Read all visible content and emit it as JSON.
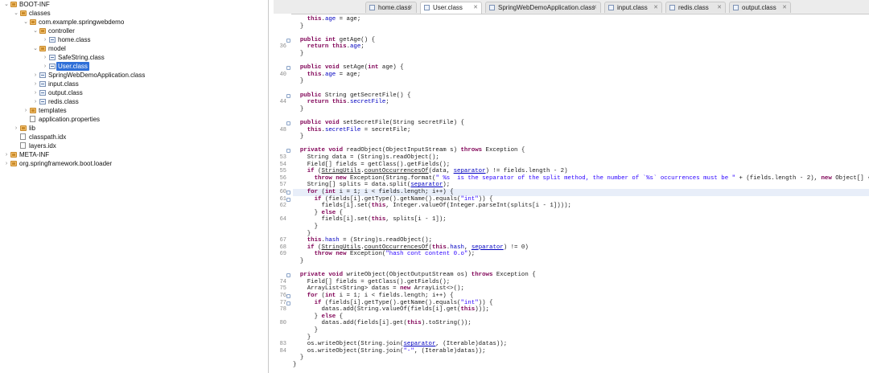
{
  "tree": {
    "items": [
      {
        "label": "BOOT-INF",
        "icon": "package-icon",
        "depth": 0,
        "arrow": "chevron-down"
      },
      {
        "label": "classes",
        "icon": "package-icon",
        "depth": 1,
        "arrow": "chevron-down"
      },
      {
        "label": "com.example.springwebdemo",
        "icon": "package-icon",
        "depth": 2,
        "arrow": "chevron-down"
      },
      {
        "label": "controller",
        "icon": "package-icon",
        "depth": 3,
        "arrow": "chevron-down"
      },
      {
        "label": "home.class",
        "icon": "class-file-icon",
        "depth": 4,
        "arrow": "chevron-right"
      },
      {
        "label": "model",
        "icon": "package-icon",
        "depth": 3,
        "arrow": "chevron-down"
      },
      {
        "label": "SafeString.class",
        "icon": "class-file-icon",
        "depth": 4,
        "arrow": "chevron-right"
      },
      {
        "label": "User.class",
        "icon": "class-file-icon",
        "depth": 4,
        "arrow": "chevron-right",
        "selected": true
      },
      {
        "label": "SpringWebDemoApplication.class",
        "icon": "class-file-icon",
        "depth": 3,
        "arrow": "chevron-right"
      },
      {
        "label": "input.class",
        "icon": "class-file-icon",
        "depth": 3,
        "arrow": "chevron-right"
      },
      {
        "label": "output.class",
        "icon": "class-file-icon",
        "depth": 3,
        "arrow": "chevron-right"
      },
      {
        "label": "redis.class",
        "icon": "class-file-icon",
        "depth": 3,
        "arrow": "chevron-right"
      },
      {
        "label": "templates",
        "icon": "package-icon",
        "depth": 2,
        "arrow": "chevron-right"
      },
      {
        "label": "application.properties",
        "icon": "file-icon",
        "depth": 2,
        "arrow": ""
      },
      {
        "label": "lib",
        "icon": "package-icon",
        "depth": 1,
        "arrow": "chevron-right"
      },
      {
        "label": "classpath.idx",
        "icon": "file-icon",
        "depth": 1,
        "arrow": ""
      },
      {
        "label": "layers.idx",
        "icon": "file-icon",
        "depth": 1,
        "arrow": ""
      },
      {
        "label": "META-INF",
        "icon": "package-icon",
        "depth": 0,
        "arrow": "chevron-right"
      },
      {
        "label": "org.springframework.boot.loader",
        "icon": "package-icon",
        "depth": 0,
        "arrow": "chevron-right"
      }
    ]
  },
  "tabs": [
    {
      "label": "home.class",
      "active": false
    },
    {
      "label": "User.class",
      "active": true
    },
    {
      "label": "SpringWebDemoApplication.class",
      "active": false
    },
    {
      "label": "input.class",
      "active": false
    },
    {
      "label": "redis.class",
      "active": false
    },
    {
      "label": "output.class",
      "active": false
    }
  ],
  "tab_close_glyph": "✕",
  "code_lines": [
    {
      "n": "",
      "t": "    this.age = age;",
      "fold": false
    },
    {
      "n": "",
      "t": "  }",
      "fold": false
    },
    {
      "n": "",
      "t": "",
      "fold": false
    },
    {
      "n": "",
      "t": "  public int getAge() {",
      "fold": true
    },
    {
      "n": "36",
      "t": "    return this.age;",
      "fold": false
    },
    {
      "n": "",
      "t": "  }",
      "fold": false
    },
    {
      "n": "",
      "t": "",
      "fold": false
    },
    {
      "n": "",
      "t": "  public void setAge(int age) {",
      "fold": true
    },
    {
      "n": "40",
      "t": "    this.age = age;",
      "fold": false
    },
    {
      "n": "",
      "t": "  }",
      "fold": false
    },
    {
      "n": "",
      "t": "",
      "fold": false
    },
    {
      "n": "",
      "t": "  public String getSecretFile() {",
      "fold": true
    },
    {
      "n": "44",
      "t": "    return this.secretFile;",
      "fold": false
    },
    {
      "n": "",
      "t": "  }",
      "fold": false
    },
    {
      "n": "",
      "t": "",
      "fold": false
    },
    {
      "n": "",
      "t": "  public void setSecretFile(String secretFile) {",
      "fold": true
    },
    {
      "n": "48",
      "t": "    this.secretFile = secretFile;",
      "fold": false
    },
    {
      "n": "",
      "t": "  }",
      "fold": false
    },
    {
      "n": "",
      "t": "",
      "fold": false
    },
    {
      "n": "",
      "t": "  private void readObject(ObjectInputStream s) throws Exception {",
      "fold": true
    },
    {
      "n": "53",
      "t": "    String data = (String)s.readObject();",
      "fold": false
    },
    {
      "n": "54",
      "t": "    Field[] fields = getClass().getFields();",
      "fold": false
    },
    {
      "n": "55",
      "t": "    if (StringUtils.countOccurrencesOf(data, separator) != fields.length - 2)",
      "fold": false
    },
    {
      "n": "56",
      "t": "      throw new Exception(String.format(\" %s  is the separator of the split method, the number of `%s` occurrences must be \" + (fields.length - 2), new Object[] { separator, separator }));",
      "fold": false
    },
    {
      "n": "57",
      "t": "    String[] splits = data.split(separator);",
      "fold": false
    },
    {
      "n": "60",
      "t": "    for (int i = 1; i < fields.length; i++) {",
      "fold": true,
      "hl": true
    },
    {
      "n": "61",
      "t": "      if (fields[i].getType().getName().equals(\"int\")) {",
      "fold": true
    },
    {
      "n": "62",
      "t": "        fields[i].set(this, Integer.valueOf(Integer.parseInt(splits[i - 1])));",
      "fold": false
    },
    {
      "n": "",
      "t": "      } else {",
      "fold": false
    },
    {
      "n": "64",
      "t": "        fields[i].set(this, splits[i - 1]);",
      "fold": false
    },
    {
      "n": "",
      "t": "      }",
      "fold": false
    },
    {
      "n": "",
      "t": "    }",
      "fold": false
    },
    {
      "n": "67",
      "t": "    this.hash = (String)s.readObject();",
      "fold": false
    },
    {
      "n": "68",
      "t": "    if (StringUtils.countOccurrencesOf(this.hash, separator) != 0)",
      "fold": false
    },
    {
      "n": "69",
      "t": "      throw new Exception(\"hash cont content 0.o\");",
      "fold": false
    },
    {
      "n": "",
      "t": "  }",
      "fold": false
    },
    {
      "n": "",
      "t": "",
      "fold": false
    },
    {
      "n": "",
      "t": "  private void writeObject(ObjectOutputStream os) throws Exception {",
      "fold": true
    },
    {
      "n": "74",
      "t": "    Field[] fields = getClass().getFields();",
      "fold": false
    },
    {
      "n": "75",
      "t": "    ArrayList<String> datas = new ArrayList<>();",
      "fold": false
    },
    {
      "n": "76",
      "t": "    for (int i = 1; i < fields.length; i++) {",
      "fold": true
    },
    {
      "n": "77",
      "t": "      if (fields[i].getType().getName().equals(\"int\")) {",
      "fold": true
    },
    {
      "n": "78",
      "t": "        datas.add(String.valueOf(fields[i].get(this)));",
      "fold": false
    },
    {
      "n": "",
      "t": "      } else {",
      "fold": false
    },
    {
      "n": "80",
      "t": "        datas.add(fields[i].get(this).toString());",
      "fold": false
    },
    {
      "n": "",
      "t": "      }",
      "fold": false
    },
    {
      "n": "",
      "t": "    }",
      "fold": false
    },
    {
      "n": "83",
      "t": "    os.writeObject(String.join(separator, (Iterable)datas));",
      "fold": false
    },
    {
      "n": "84",
      "t": "    os.writeObject(String.join(\"-\", (Iterable)datas));",
      "fold": false
    },
    {
      "n": "",
      "t": "  }",
      "fold": false
    },
    {
      "n": "",
      "t": "}",
      "fold": false
    }
  ],
  "colors": {
    "keyword": "#7f0055",
    "string": "#2a00ff",
    "field": "#0000c0",
    "selection": "#2f6fd8",
    "current_line": "#e8eef9"
  }
}
